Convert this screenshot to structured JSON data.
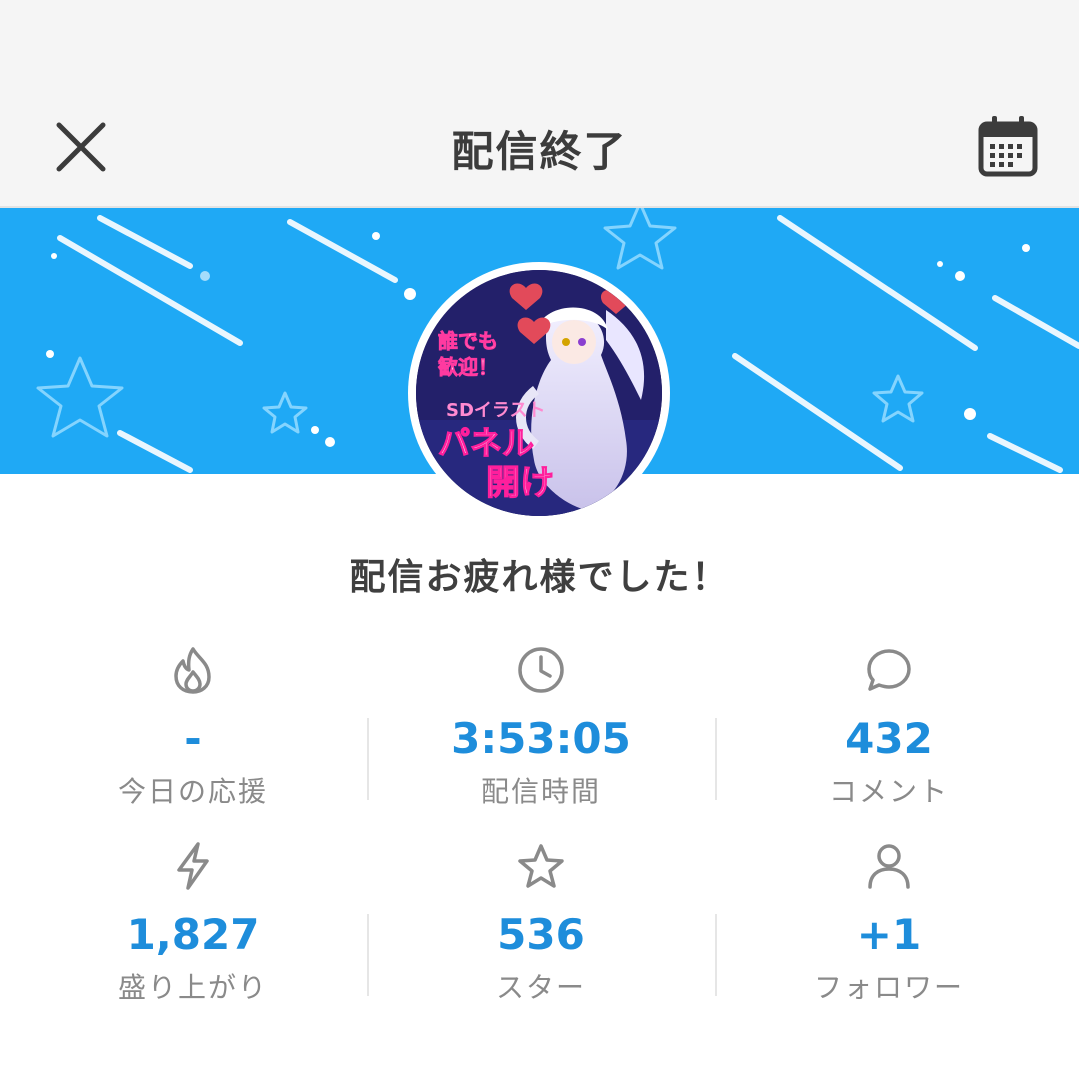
{
  "header": {
    "title": "配信終了",
    "close_icon": "close-icon",
    "calendar_icon": "calendar-icon"
  },
  "banner": {
    "background_color": "#1fa9f5"
  },
  "avatar": {
    "text_line1": "誰でも",
    "text_line2": "歓迎！",
    "text_line3": "SDイラスト",
    "text_line4": "パネル",
    "text_line5": "開け"
  },
  "message": "配信お疲れ様でした！",
  "stats": [
    {
      "icon": "flame-icon",
      "value": "-",
      "label": "今日の応援"
    },
    {
      "icon": "clock-icon",
      "value": "3:53:05",
      "label": "配信時間"
    },
    {
      "icon": "comment-icon",
      "value": "432",
      "label": "コメント"
    },
    {
      "icon": "lightning-icon",
      "value": "1,827",
      "label": "盛り上がり"
    },
    {
      "icon": "star-icon",
      "value": "536",
      "label": "スター"
    },
    {
      "icon": "person-icon",
      "value": "+1",
      "label": "フォロワー"
    }
  ],
  "colors": {
    "accent": "#1e8ddb",
    "label": "#8a8a8a",
    "header_bg": "#f5f5f5"
  }
}
